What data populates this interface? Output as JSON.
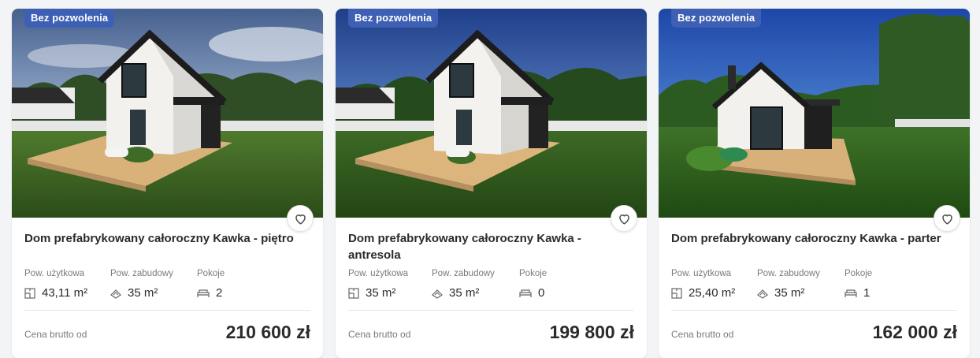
{
  "listings": [
    {
      "badge": "Bez pozwolenia",
      "title": "Dom prefabrykowany całoroczny Kawka - piętro",
      "usable_area_label": "Pow. użytkowa",
      "usable_area": "43,11 m²",
      "built_area_label": "Pow. zabudowy",
      "built_area": "35 m²",
      "rooms_label": "Pokoje",
      "rooms": "2",
      "price_label": "Cena brutto od",
      "price": "210 600 zł"
    },
    {
      "badge": "Bez pozwolenia",
      "title": "Dom prefabrykowany całoroczny Kawka - antresola",
      "usable_area_label": "Pow. użytkowa",
      "usable_area": "35 m²",
      "built_area_label": "Pow. zabudowy",
      "built_area": "35 m²",
      "rooms_label": "Pokoje",
      "rooms": "0",
      "price_label": "Cena brutto od",
      "price": "199 800 zł"
    },
    {
      "badge": "Bez pozwolenia",
      "title": "Dom prefabrykowany całoroczny Kawka - parter",
      "usable_area_label": "Pow. użytkowa",
      "usable_area": "25,40 m²",
      "built_area_label": "Pow. zabudowy",
      "built_area": "35 m²",
      "rooms_label": "Pokoje",
      "rooms": "1",
      "price_label": "Cena brutto od",
      "price": "162 000 zł"
    }
  ],
  "colors": {
    "badge_bg": "#3d5fb4",
    "page_bg": "#f3f4f6",
    "text": "#2b2b2b",
    "muted": "#7a7a7a"
  },
  "icons": [
    "heart-icon",
    "floor-plan-icon",
    "built-area-icon",
    "bed-icon"
  ]
}
